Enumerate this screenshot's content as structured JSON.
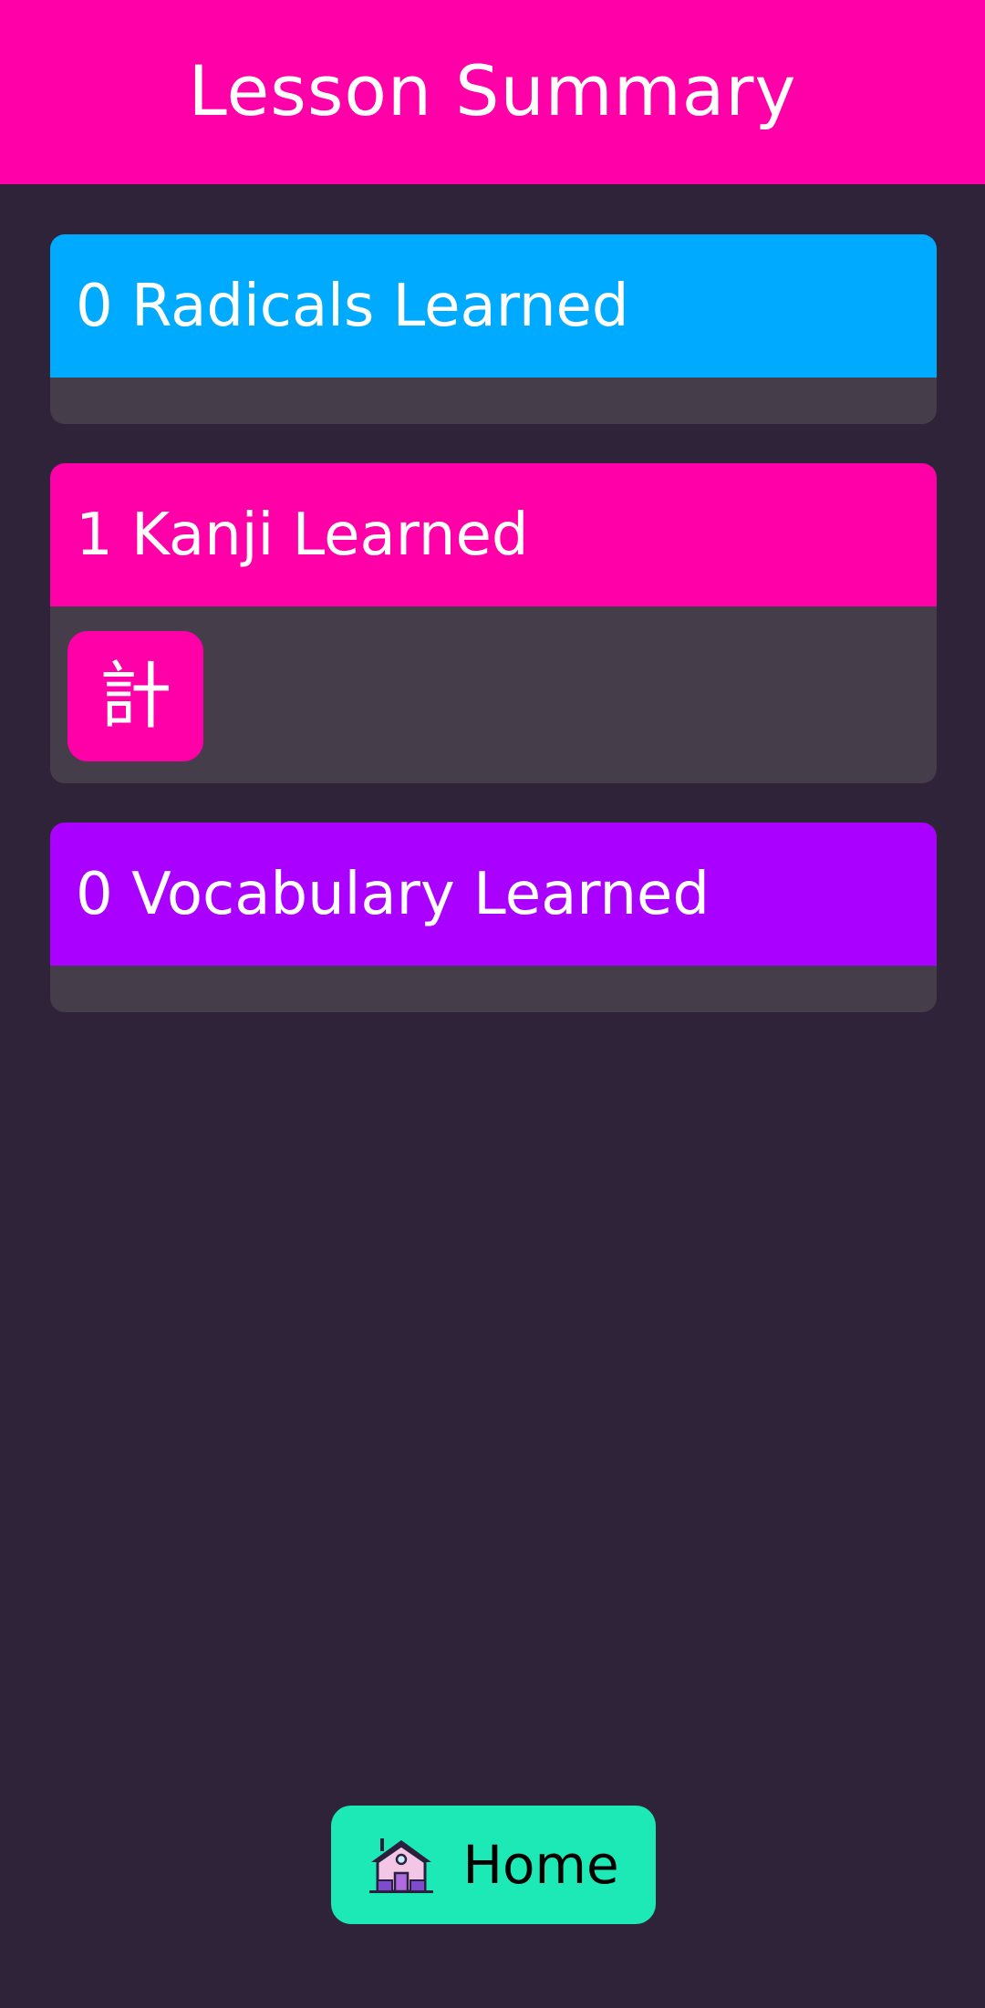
{
  "header": {
    "title": "Lesson Summary"
  },
  "colors": {
    "background": "#2f233a",
    "header": "#ff00a8",
    "radicals": "#00aaff",
    "kanji": "#ff00a8",
    "vocabulary": "#aa00ff",
    "card_body": "#453d4a",
    "home_button": "#1de9b6"
  },
  "sections": {
    "radicals": {
      "title": "0 Radicals Learned",
      "items": []
    },
    "kanji": {
      "title": "1 Kanji Learned",
      "items": [
        {
          "character": "計"
        }
      ]
    },
    "vocabulary": {
      "title": "0 Vocabulary Learned",
      "items": []
    }
  },
  "footer": {
    "home_button": {
      "label": "Home",
      "icon": "house-icon"
    }
  }
}
